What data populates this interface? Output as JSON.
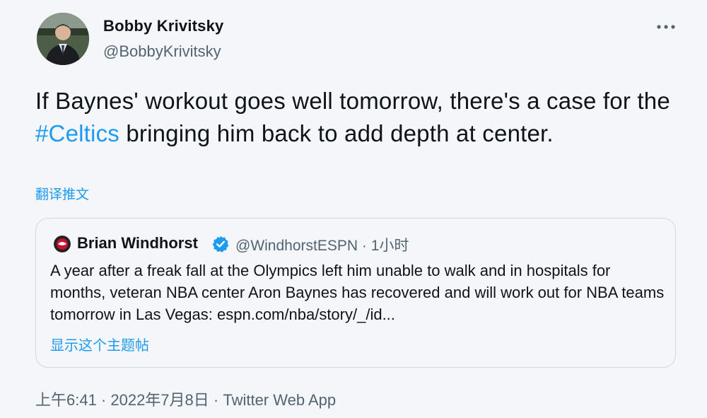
{
  "author": {
    "name": "Bobby Krivitsky",
    "handle": "@BobbyKrivitsky"
  },
  "tweet": {
    "text_before": "If Baynes' workout goes well tomorrow, there's a case for the ",
    "hashtag": "#Celtics",
    "text_after": " bringing him back to add depth at center.",
    "translate_label": "翻译推文"
  },
  "quote": {
    "name": "Brian Windhorst",
    "handle_time": "@WindhorstESPN · 1小时",
    "text": "A year after a freak fall at the Olympics left him unable to walk and in hospitals for months, veteran NBA center Aron Baynes has recovered and will work out for NBA teams tomorrow in Las Vegas: espn.com/nba/story/_/id...",
    "show_thread_label": "显示这个主题帖"
  },
  "meta": {
    "time_date": "上午6:41 · 2022年7月8日 · ",
    "app": "Twitter Web App"
  },
  "colors": {
    "link_blue": "#1d9bf0",
    "secondary_text": "#536471",
    "border": "#cfd9de"
  },
  "icons": {
    "more": "more-horizontal-icon",
    "verified": "verified-badge-icon"
  }
}
